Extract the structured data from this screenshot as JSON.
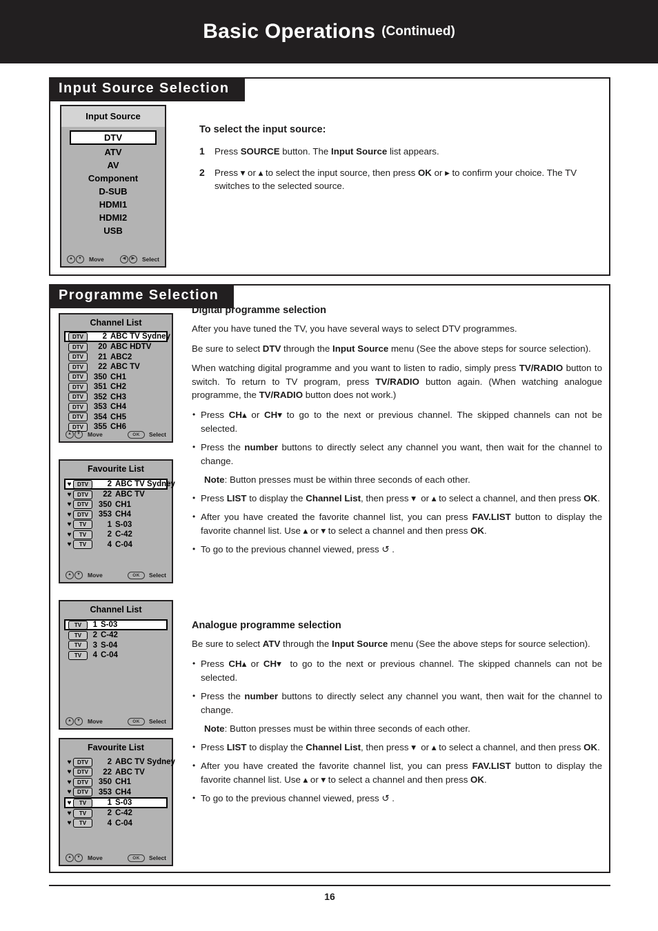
{
  "header": {
    "title": "Basic Operations",
    "subtitle": "(Continued)"
  },
  "sections": {
    "input_source": {
      "banner": "Input  Source  Selection",
      "osd": {
        "title": "Input Source",
        "items": [
          {
            "label": "DTV",
            "selected": true
          },
          {
            "label": "ATV",
            "selected": false
          },
          {
            "label": "AV",
            "selected": false
          },
          {
            "label": "Component",
            "selected": false
          },
          {
            "label": "D-SUB",
            "selected": false
          },
          {
            "label": "HDMI1",
            "selected": false
          },
          {
            "label": "HDMI2",
            "selected": false
          },
          {
            "label": "USB",
            "selected": false
          }
        ],
        "footer": {
          "move_icons": "up-down-arrow-icon",
          "move_label": "Move",
          "select_icons": "left-right-arrow-icon",
          "select_label": "Select"
        }
      },
      "heading": "To select the input source:",
      "steps": [
        {
          "num": "1",
          "text_html": "Press <span class=\"b\">SOURCE</span> button. The <span class=\"b\">Input Source</span> list appears."
        },
        {
          "num": "2",
          "text_html": "Press ▾ or ▴ to select the input source, then press <span class=\"b\">OK</span> or ▸ to confirm your choice. The TV switches to the selected source."
        }
      ]
    },
    "programme_selection": {
      "banner": "Programme  Selection",
      "panels": [
        {
          "name": "channel-list-digital",
          "title": "Channel List",
          "rows": [
            {
              "heart": false,
              "badge": "DTV",
              "num": "2",
              "name": "ABC TV Sydney",
              "selected": true
            },
            {
              "heart": false,
              "badge": "DTV",
              "num": "20",
              "name": "ABC HDTV",
              "selected": false
            },
            {
              "heart": false,
              "badge": "DTV",
              "num": "21",
              "name": "ABC2",
              "selected": false
            },
            {
              "heart": false,
              "badge": "DTV",
              "num": "22",
              "name": "ABC TV",
              "selected": false
            },
            {
              "heart": false,
              "badge": "DTV",
              "num": "350",
              "name": "CH1",
              "selected": false
            },
            {
              "heart": false,
              "badge": "DTV",
              "num": "351",
              "name": "CH2",
              "selected": false
            },
            {
              "heart": false,
              "badge": "DTV",
              "num": "352",
              "name": "CH3",
              "selected": false
            },
            {
              "heart": false,
              "badge": "DTV",
              "num": "353",
              "name": "CH4",
              "selected": false
            },
            {
              "heart": false,
              "badge": "DTV",
              "num": "354",
              "name": "CH5",
              "selected": false
            },
            {
              "heart": false,
              "badge": "DTV",
              "num": "355",
              "name": "CH6",
              "selected": false
            }
          ],
          "footer": {
            "move_label": "Move",
            "select_label": "Select",
            "select_key": "OK"
          }
        },
        {
          "name": "favourite-list-digital",
          "title": "Favourite List",
          "rows": [
            {
              "heart": true,
              "badge": "DTV",
              "num": "2",
              "name": "ABC TV Sydney",
              "selected": true
            },
            {
              "heart": true,
              "badge": "DTV",
              "num": "22",
              "name": "ABC TV",
              "selected": false
            },
            {
              "heart": true,
              "badge": "DTV",
              "num": "350",
              "name": "CH1",
              "selected": false
            },
            {
              "heart": true,
              "badge": "DTV",
              "num": "353",
              "name": "CH4",
              "selected": false
            },
            {
              "heart": true,
              "badge": "TV",
              "num": "1",
              "name": "S-03",
              "selected": false
            },
            {
              "heart": true,
              "badge": "TV",
              "num": "2",
              "name": "C-42",
              "selected": false
            },
            {
              "heart": true,
              "badge": "TV",
              "num": "4",
              "name": "C-04",
              "selected": false
            }
          ],
          "footer": {
            "move_label": "Move",
            "select_label": "Select",
            "select_key": "OK"
          }
        },
        {
          "name": "channel-list-analogue",
          "title": "Channel List",
          "rows": [
            {
              "heart": false,
              "badge": "TV",
              "num": "1",
              "name": "S-03",
              "selected": true
            },
            {
              "heart": false,
              "badge": "TV",
              "num": "2",
              "name": "C-42",
              "selected": false
            },
            {
              "heart": false,
              "badge": "TV",
              "num": "3",
              "name": "S-04",
              "selected": false
            },
            {
              "heart": false,
              "badge": "TV",
              "num": "4",
              "name": "C-04",
              "selected": false
            }
          ],
          "footer": {
            "move_label": "Move",
            "select_label": "Select",
            "select_key": "OK"
          }
        },
        {
          "name": "favourite-list-analogue",
          "title": "Favourite List",
          "rows": [
            {
              "heart": true,
              "badge": "DTV",
              "num": "2",
              "name": "ABC TV Sydney",
              "selected": false
            },
            {
              "heart": true,
              "badge": "DTV",
              "num": "22",
              "name": "ABC TV",
              "selected": false
            },
            {
              "heart": true,
              "badge": "DTV",
              "num": "350",
              "name": "CH1",
              "selected": false
            },
            {
              "heart": true,
              "badge": "DTV",
              "num": "353",
              "name": "CH4",
              "selected": false
            },
            {
              "heart": true,
              "badge": "TV",
              "num": "1",
              "name": "S-03",
              "selected": true
            },
            {
              "heart": true,
              "badge": "TV",
              "num": "2",
              "name": "C-42",
              "selected": false
            },
            {
              "heart": true,
              "badge": "TV",
              "num": "4",
              "name": "C-04",
              "selected": false
            }
          ],
          "footer": {
            "move_label": "Move",
            "select_label": "Select",
            "select_key": "OK"
          }
        }
      ],
      "digital": {
        "heading": "Digital programme selection",
        "paragraphs": [
          "After you have tuned the TV, you have several ways to select DTV programmes.",
          "Be sure to select <span class=\"b\">DTV</span> through the <span class=\"b\">Input Source</span> menu (See the above steps for source selection).",
          "When watching digital programme and you want to listen to radio, simply press <span class=\"b\">TV/RADIO</span> button to switch. To return to TV program, press <span class=\"b\">TV/RADIO</span> button again. (When watching analogue programme, the <span class=\"b\">TV/RADIO</span> button does not work.)"
        ],
        "bullets": [
          {
            "type": "bullet",
            "text_html": "Press <span class=\"b\">CH</span>▴ or <span class=\"b\">CH</span>▾ to go to the next or previous channel. The skipped channels can not be selected."
          },
          {
            "type": "bullet",
            "text_html": "Press the <span class=\"b\">number</span> buttons to directly select any channel you want, then wait for the channel to change."
          },
          {
            "type": "note",
            "text_html": "<span class=\"b\">Note</span>: Button presses must be within three seconds of each other."
          },
          {
            "type": "bullet",
            "text_html": "Press <span class=\"b\">LIST</span> to display the <span class=\"b\">Channel List</span>, then press ▾&nbsp; or ▴ to select a channel, and then press <span class=\"b\">OK</span>."
          },
          {
            "type": "bullet",
            "text_html": "After you have created the favorite channel list, you can press <span class=\"b\">FAV.LIST</span> button to display the favorite channel list. Use ▴ or ▾ to select a channel and then press <span class=\"b\">OK</span>."
          },
          {
            "type": "bullet",
            "text_html": "To go to the previous channel viewed, press ↺ ."
          }
        ]
      },
      "analogue": {
        "heading": "Analogue programme selection",
        "paragraphs": [
          "Be sure to select <span class=\"b\">ATV</span> through the <span class=\"b\">Input Source</span> menu (See the above steps for source selection)."
        ],
        "bullets": [
          {
            "type": "bullet",
            "text_html": "Press <span class=\"b\">CH</span>▴ or <span class=\"b\">CH</span>▾&nbsp; to go to the next or previous channel. The skipped channels can not be selected."
          },
          {
            "type": "bullet",
            "text_html": "Press the <span class=\"b\">number</span> buttons to directly select any channel you want, then wait for the channel to change."
          },
          {
            "type": "note",
            "text_html": "<span class=\"b\">Note</span>: Button presses must be within three seconds of each other."
          },
          {
            "type": "bullet",
            "text_html": "Press <span class=\"b\">LIST</span> to display the <span class=\"b\">Channel List</span>, then press ▾&nbsp; or ▴ to select a channel, and then press <span class=\"b\">OK</span>."
          },
          {
            "type": "bullet",
            "text_html": "After you have created the favorite channel list, you can press <span class=\"b\">FAV.LIST</span> button to display the favorite channel list. Use ▴ or ▾ to select a channel and then press <span class=\"b\">OK</span>."
          },
          {
            "type": "bullet",
            "text_html": "To go to the previous channel viewed, press ↺ ."
          }
        ]
      }
    }
  },
  "footer": {
    "page_number": "16"
  },
  "colors": {
    "header_band": "#221f20",
    "osd_background": "#b3b3b3",
    "osd_title_background": "#d4d4d4",
    "selection_highlight": "#ffffff",
    "text": "#1c1b1b"
  }
}
